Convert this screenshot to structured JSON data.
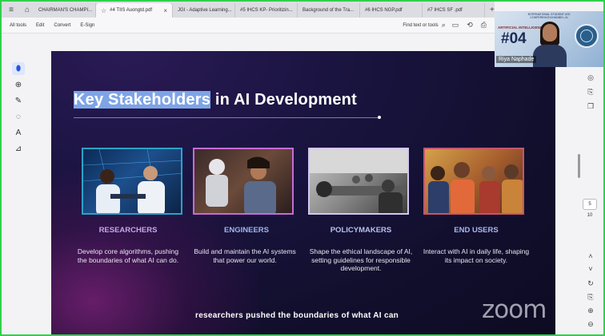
{
  "tabs": [
    {
      "label": "CHAIRMAN'S CHAMPI...",
      "active": false
    },
    {
      "label": "#4 TIIS Auongtd.pdf",
      "active": true
    },
    {
      "label": "JGI - Adaptive Learning...",
      "active": false
    },
    {
      "label": "#5 IHCS KP- Prioritizin...",
      "active": false
    },
    {
      "label": "Background of the Tra...",
      "active": false
    },
    {
      "label": "#6 IHCS NGP.pdf",
      "active": false
    },
    {
      "label": "#7 IHCS SF .pdf",
      "active": false
    }
  ],
  "toolbar": {
    "menus": [
      "All tools",
      "Edit",
      "Convert",
      "E-Sign"
    ],
    "find_label": "Find text or tools"
  },
  "viewer": {
    "page_number": "5",
    "page_total": "10"
  },
  "slide": {
    "title_highlight": "Key Stakeholders",
    "title_rest": " in AI Development",
    "cards": [
      {
        "title": "RESEARCHERS",
        "color": "#c9a6e8",
        "desc": "Develop core algorithms, pushing the boundaries of what AI can do."
      },
      {
        "title": "ENGINEERS",
        "color": "#9fb6ee",
        "desc": "Build and maintain the AI systems that power our world."
      },
      {
        "title": "POLICYMAKERS",
        "color": "#b8c2ee",
        "desc": "Shape the ethical landscape of AI, setting guidelines for responsible development."
      },
      {
        "title": "END USERS",
        "color": "#a9b7f0",
        "desc": "Interact with AI in daily life, shaping its impact on society."
      }
    ],
    "caption": "researchers pushed the boundaries of what AI can",
    "watermark": "zoom"
  },
  "video": {
    "header": "INTERNATIONAL STUDENT LED CONFERENCE/CHANNEL: AI",
    "subheader": "ARTIFICIAL INTELLIGENCE",
    "number": "#04",
    "name": "Riya Naphade"
  },
  "colors": {
    "frame_border": "#2fd14a",
    "slide_bg": "#120f2e",
    "card_border": "#29a3c8",
    "active_tool": "#2857d4"
  },
  "icons": {
    "tab_bar": [
      "menu-icon",
      "home-icon",
      "star-icon",
      "close-icon",
      "plus-icon"
    ],
    "toolbar": [
      "search-icon",
      "save-icon",
      "share-icon",
      "print-icon"
    ],
    "left_tools": [
      "cursor-icon",
      "zoom-icon",
      "pen-icon",
      "eraser-icon",
      "text-select-icon",
      "stamp-icon"
    ],
    "right_tools": [
      "comment-icon",
      "export-icon",
      "copy-icon",
      "refresh-icon",
      "save-page-icon",
      "zoom-in-icon",
      "zoom-out-icon"
    ]
  }
}
